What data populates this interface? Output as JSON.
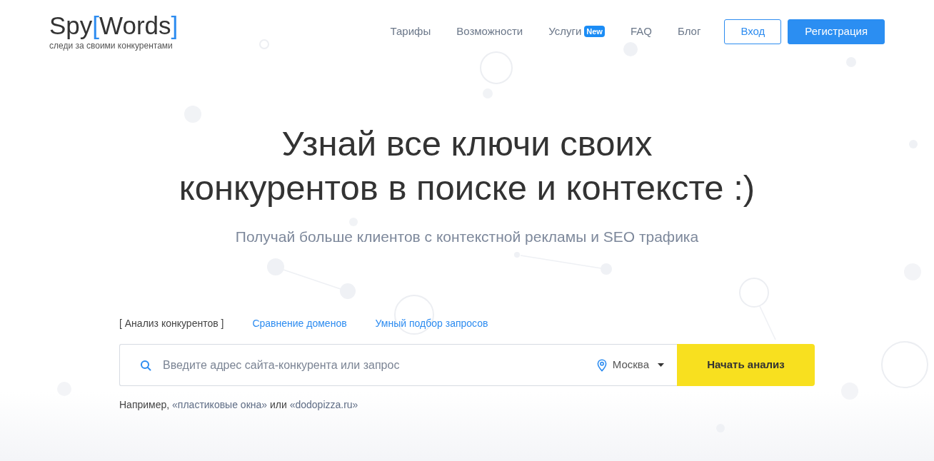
{
  "header": {
    "logo": {
      "word": "Spy",
      "bracket_open": "[",
      "highlight": "Words",
      "bracket_close": "]",
      "tagline": "следи за своими конкурентами"
    },
    "nav": [
      {
        "label": "Тарифы"
      },
      {
        "label": "Возможности"
      },
      {
        "label": "Услуги",
        "badge": "New"
      },
      {
        "label": "FAQ"
      },
      {
        "label": "Блог"
      }
    ],
    "buttons": [
      {
        "label": "Вход",
        "kind": "outline"
      },
      {
        "label": "Регистрация",
        "kind": "primary"
      }
    ]
  },
  "hero": {
    "heading_lines": [
      "Узнай все ключи своих",
      "конкурентов в поиске и контексте :)"
    ],
    "subtitle": "Получай больше клиентов с контекстной рекламы и SEO трафика"
  },
  "search": {
    "tab_brackets": [
      "[",
      "]"
    ],
    "tabs": [
      {
        "label": "Анализ конкурентов",
        "selected": true
      },
      {
        "label": "Сравнение доменов",
        "selected": false
      },
      {
        "label": "Умный подбор запросов",
        "selected": false
      }
    ],
    "placeholder": "Введите адрес сайта-конкурента или запрос",
    "region": "Москва",
    "submit": "Начать анализ",
    "example": {
      "prefix": "Например,",
      "links": [
        "«пластиковые окна»",
        "«dodopizza.ru»"
      ],
      "joiner": "или"
    }
  }
}
